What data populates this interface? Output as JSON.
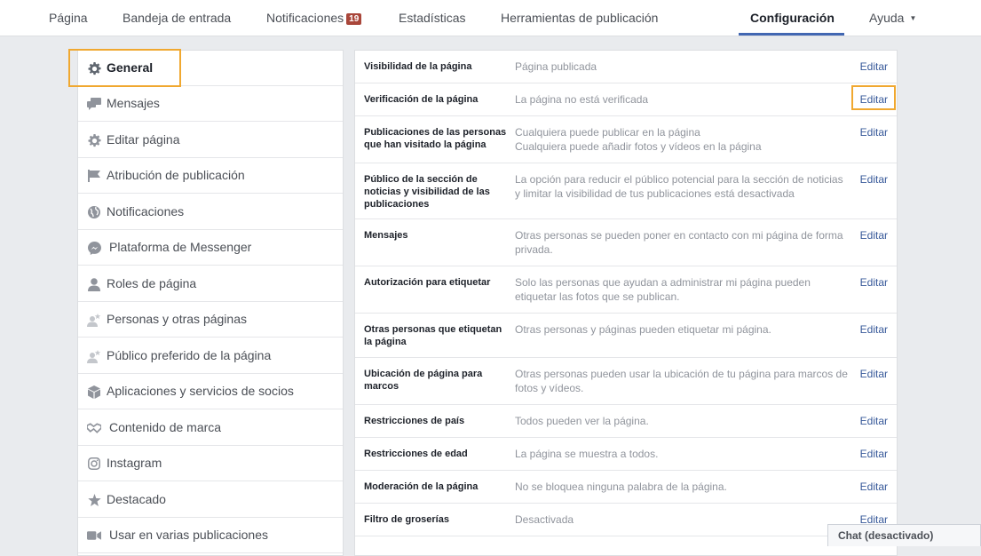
{
  "topnav": {
    "items": [
      {
        "label": "Página"
      },
      {
        "label": "Bandeja de entrada"
      },
      {
        "label": "Notificaciones",
        "badge": "19"
      },
      {
        "label": "Estadísticas"
      },
      {
        "label": "Herramientas de publicación"
      },
      {
        "label": "Configuración"
      },
      {
        "label": "Ayuda"
      }
    ]
  },
  "sidebar": {
    "items": [
      {
        "label": "General",
        "icon": "gear-icon"
      },
      {
        "label": "Mensajes",
        "icon": "chat-bubbles-icon"
      },
      {
        "label": "Editar página",
        "icon": "gear-icon"
      },
      {
        "label": "Atribución de publicación",
        "icon": "flag-icon"
      },
      {
        "label": "Notificaciones",
        "icon": "globe-icon"
      },
      {
        "label": "Plataforma de Messenger",
        "icon": "messenger-icon"
      },
      {
        "label": "Roles de página",
        "icon": "person-icon"
      },
      {
        "label": "Personas y otras páginas",
        "icon": "person-star-icon"
      },
      {
        "label": "Público preferido de la página",
        "icon": "person-star-icon"
      },
      {
        "label": "Aplicaciones y servicios de socios",
        "icon": "cube-icon"
      },
      {
        "label": "Contenido de marca",
        "icon": "handshake-icon"
      },
      {
        "label": "Instagram",
        "icon": "instagram-icon"
      },
      {
        "label": "Destacado",
        "icon": "star-icon"
      },
      {
        "label": "Usar en varias publicaciones",
        "icon": "video-camera-icon"
      }
    ]
  },
  "settings": {
    "edit_label": "Editar",
    "rows": [
      {
        "label": "Visibilidad de la página",
        "values": [
          "Página publicada"
        ]
      },
      {
        "label": "Verificación de la página",
        "values": [
          "La página no está verificada"
        ]
      },
      {
        "label": "Publicaciones de las personas que han visitado la página",
        "values": [
          "Cualquiera puede publicar en la página",
          "Cualquiera puede añadir fotos y vídeos en la página"
        ]
      },
      {
        "label": "Público de la sección de noticias y visibilidad de las publicaciones",
        "values": [
          "La opción para reducir el público potencial para la sección de noticias y limitar la visibilidad de tus publicaciones está desactivada"
        ]
      },
      {
        "label": "Mensajes",
        "values": [
          "Otras personas se pueden poner en contacto con mi página de forma privada."
        ]
      },
      {
        "label": "Autorización para etiquetar",
        "values": [
          "Solo las personas que ayudan a administrar mi página pueden etiquetar las fotos que se publican."
        ]
      },
      {
        "label": "Otras personas que etiquetan la página",
        "values": [
          "Otras personas y páginas pueden etiquetar mi página."
        ]
      },
      {
        "label": "Ubicación de página para marcos",
        "values": [
          "Otras personas pueden usar la ubicación de tu página para marcos de fotos y vídeos."
        ]
      },
      {
        "label": "Restricciones de país",
        "values": [
          "Todos pueden ver la página."
        ]
      },
      {
        "label": "Restricciones de edad",
        "values": [
          "La página se muestra a todos."
        ]
      },
      {
        "label": "Moderación de la página",
        "values": [
          "No se bloquea ninguna palabra de la página."
        ]
      },
      {
        "label": "Filtro de groserías",
        "values": [
          "Desactivada"
        ]
      }
    ]
  },
  "chat": {
    "label": "Chat (desactivado)"
  },
  "colors": {
    "accent": "#4267b2",
    "highlight": "#f0a830",
    "link": "#365899",
    "badge": "#a9463a"
  }
}
